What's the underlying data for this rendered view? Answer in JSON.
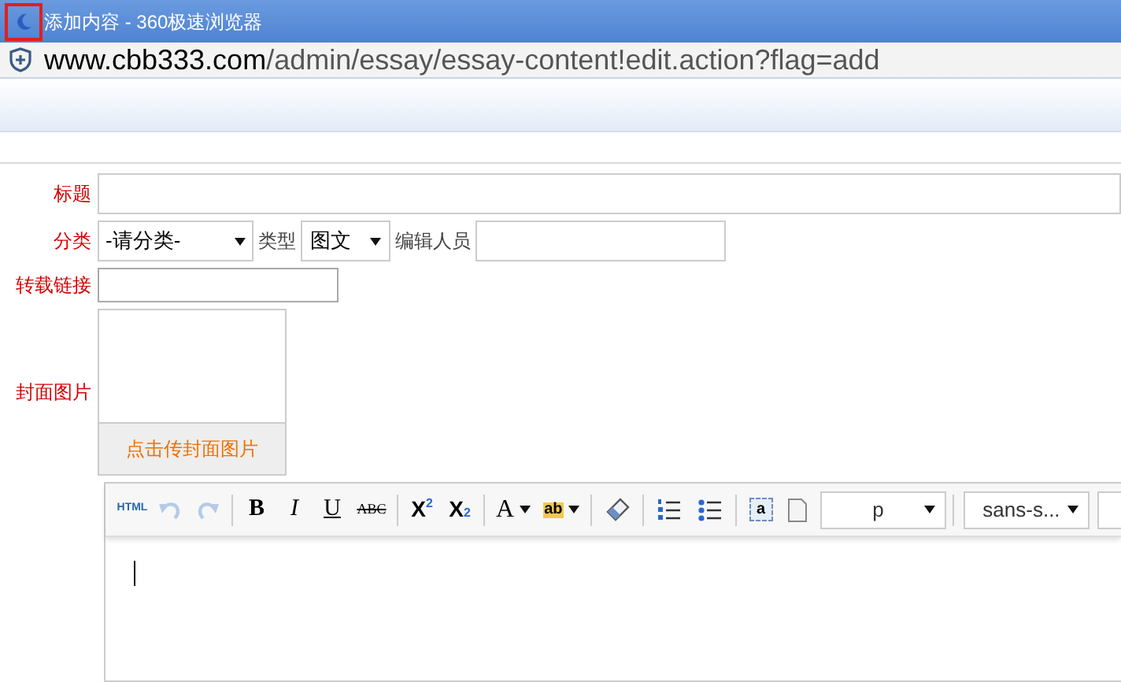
{
  "window": {
    "title": "添加内容 - 360极速浏览器"
  },
  "address": {
    "host": "www.cbb333.com",
    "path": "/admin/essay/essay-content!edit.action?flag=add"
  },
  "form": {
    "title": {
      "label": "标题"
    },
    "category": {
      "label": "分类",
      "value": "-请分类-"
    },
    "type": {
      "label": "类型",
      "value": "图文"
    },
    "editor": {
      "label": "编辑人员"
    },
    "repost": {
      "label": "转载链接"
    },
    "cover": {
      "label": "封面图片",
      "button": "点击传封面图片"
    }
  },
  "toolbar": [
    {
      "kind": "html",
      "text": "HTML"
    },
    {
      "kind": "undo",
      "disabled": true
    },
    {
      "kind": "redo",
      "disabled": true
    },
    {
      "kind": "sep"
    },
    {
      "kind": "bold",
      "text": "B"
    },
    {
      "kind": "italic",
      "text": "I"
    },
    {
      "kind": "underline",
      "text": "U"
    },
    {
      "kind": "strike",
      "text": "ABC"
    },
    {
      "kind": "sep"
    },
    {
      "kind": "sup",
      "text": "X",
      "index": "2"
    },
    {
      "kind": "sub",
      "text": "X",
      "index": "2"
    },
    {
      "kind": "sep"
    },
    {
      "kind": "fontcolor",
      "text": "A"
    },
    {
      "kind": "highlight",
      "text": "ab"
    },
    {
      "kind": "sep"
    },
    {
      "kind": "eraser"
    },
    {
      "kind": "sep"
    },
    {
      "kind": "ol"
    },
    {
      "kind": "ul"
    },
    {
      "kind": "sep"
    },
    {
      "kind": "anchor",
      "text": "a"
    },
    {
      "kind": "page"
    },
    {
      "kind": "select",
      "text": "p"
    },
    {
      "kind": "sep"
    },
    {
      "kind": "select",
      "text": "sans-s..."
    },
    {
      "kind": "stub"
    }
  ]
}
